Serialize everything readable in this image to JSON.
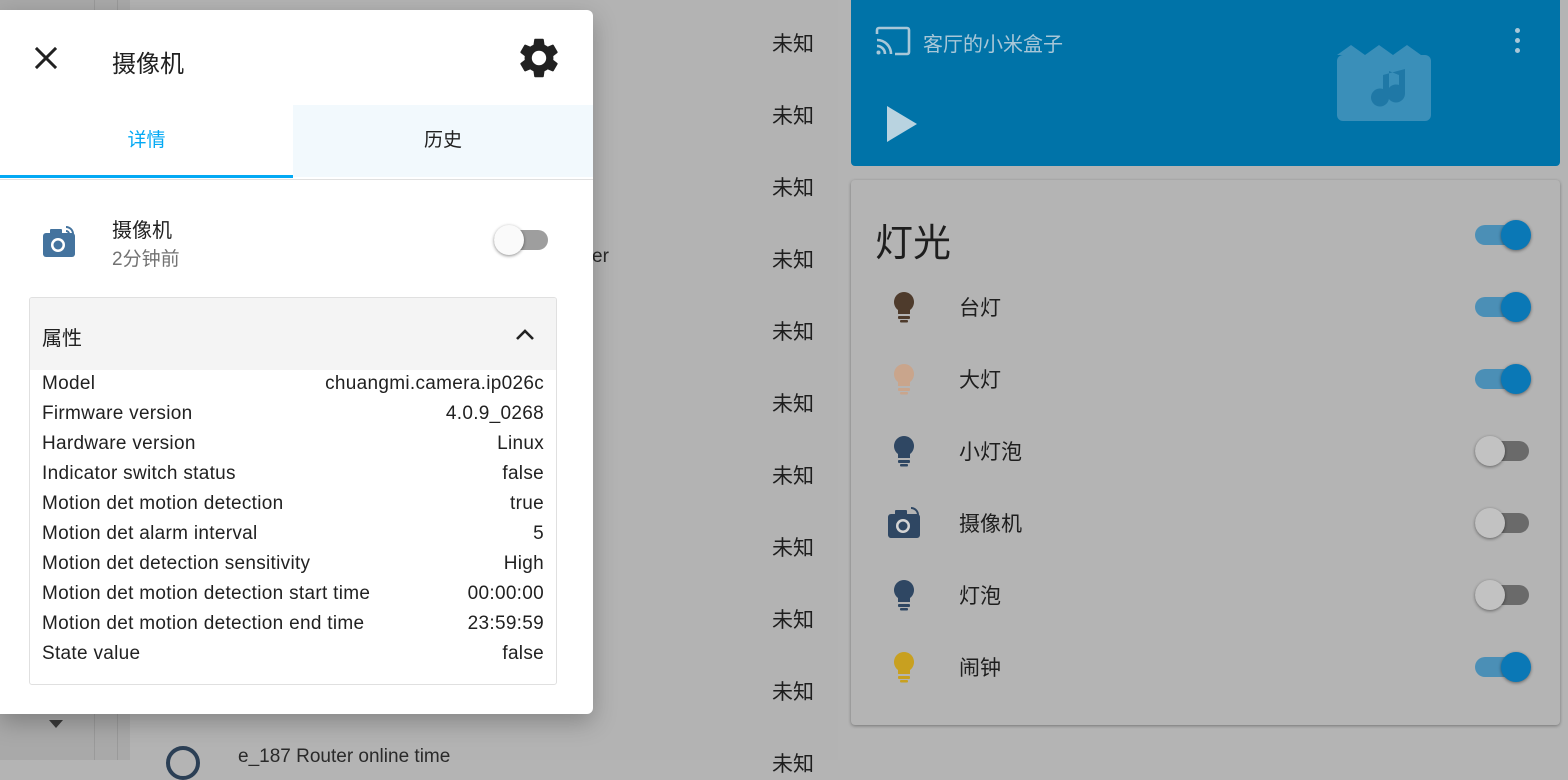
{
  "background": {
    "status_values": [
      "未知",
      "未知",
      "未知",
      "未知",
      "未知",
      "未知",
      "未知",
      "未知",
      "未知",
      "未知",
      "未知"
    ],
    "fragments": {
      "row_fragment": "er",
      "last_row_label": "e_187 Router online time"
    }
  },
  "media_card": {
    "title": "客厅的小米盒子",
    "accent": "#0073a8"
  },
  "lights_card": {
    "title": "灯光",
    "master_on": true,
    "items": [
      {
        "label": "台灯",
        "icon": "lightbulb-icon",
        "icon_color": "#4e3b2c",
        "on": true
      },
      {
        "label": "大灯",
        "icon": "lightbulb-icon",
        "icon_color": "#c9a58c",
        "on": true
      },
      {
        "label": "小灯泡",
        "icon": "lightbulb-icon",
        "icon_color": "#2f4763",
        "on": false
      },
      {
        "label": "摄像机",
        "icon": "camera-icon",
        "icon_color": "#2f4763",
        "on": false
      },
      {
        "label": "灯泡",
        "icon": "lightbulb-icon",
        "icon_color": "#2f4763",
        "on": false
      },
      {
        "label": "闹钟",
        "icon": "lightbulb-icon",
        "icon_color": "#c8a020",
        "on": true
      }
    ]
  },
  "dialog": {
    "title": "摄像机",
    "tabs": [
      {
        "label": "详情",
        "active": true
      },
      {
        "label": "历史",
        "active": false
      }
    ],
    "entity": {
      "name": "摄像机",
      "last_changed": "2分钟前",
      "state_on": false,
      "icon": "camera-icon",
      "icon_color": "#44739e"
    },
    "attributes": {
      "header": "属性",
      "rows": [
        {
          "key": "Model",
          "value": "chuangmi.camera.ip026c"
        },
        {
          "key": "Firmware version",
          "value": "4.0.9_0268"
        },
        {
          "key": "Hardware version",
          "value": "Linux"
        },
        {
          "key": "Indicator switch status",
          "value": "false"
        },
        {
          "key": "Motion det motion detection",
          "value": "true"
        },
        {
          "key": "Motion det alarm interval",
          "value": "5"
        },
        {
          "key": "Motion det detection sensitivity",
          "value": "High"
        },
        {
          "key": "Motion det motion detection start time",
          "value": "00:00:00"
        },
        {
          "key": "Motion det motion detection end time",
          "value": "23:59:59"
        },
        {
          "key": "State value",
          "value": "false"
        }
      ]
    }
  }
}
